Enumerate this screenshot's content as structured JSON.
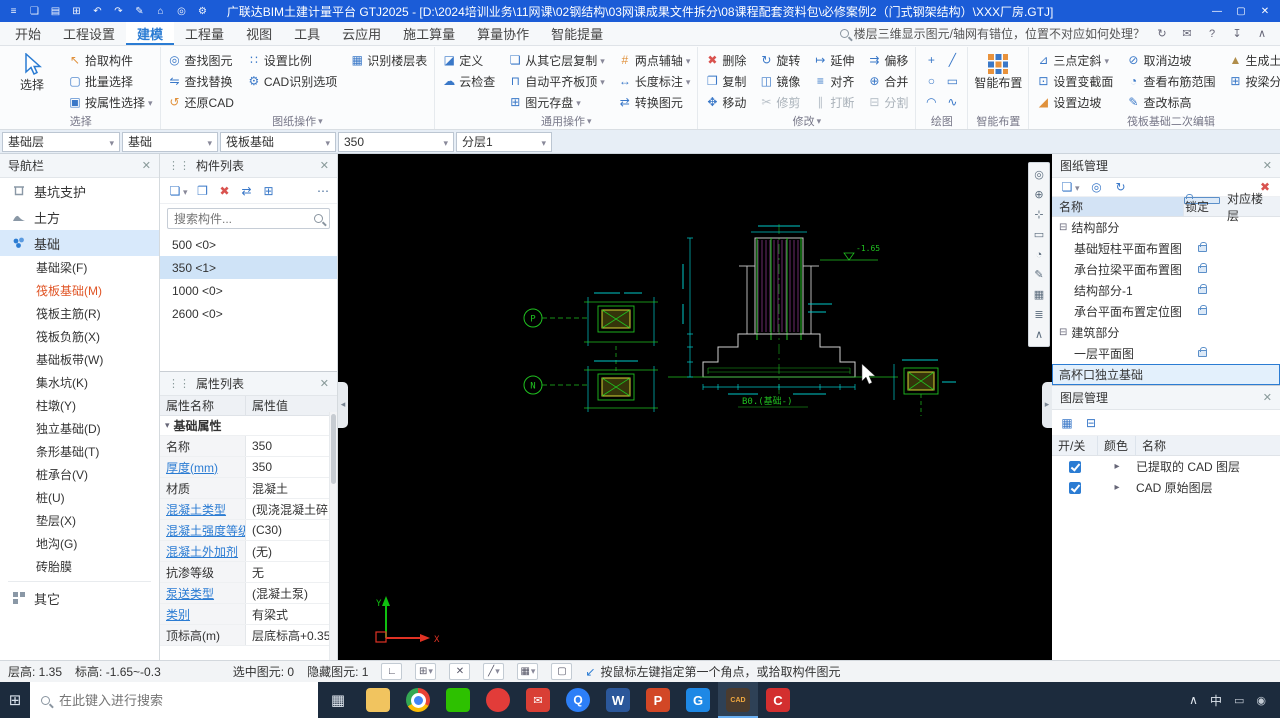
{
  "title_bar": {
    "title": "广联达BIM土建计量平台 GTJ2025 - [D:\\2024培训业务\\11网课\\02钢结构\\03网课成果文件拆分\\08课程配套资料包\\必修案例2（门式钢架结构）\\XXX厂房.GTJ]"
  },
  "tabs": {
    "items": [
      "开始",
      "工程设置",
      "建模",
      "工程量",
      "视图",
      "工具",
      "云应用",
      "施工算量",
      "算量协作",
      "智能提量"
    ],
    "active_tab": "建模",
    "help_query": "楼层三维显示图元/轴网有错位，位置不对应如何处理？"
  },
  "ribbon": {
    "g1": {
      "label": "选择",
      "big": "选择",
      "col": [
        "拾取构件",
        "批量选择",
        "按属性选择"
      ]
    },
    "g2": {
      "label": "图纸操作",
      "col1": [
        "查找图元",
        "查找替换",
        "还原CAD"
      ],
      "col2": [
        "设置比例",
        "CAD识别选项"
      ],
      "col3": [
        "识别楼层表"
      ]
    },
    "g3": {
      "label": "通用操作",
      "col1": [
        "定义",
        "云检查"
      ],
      "col2": [
        "从其它层复制",
        "自动平齐板顶",
        "图元存盘"
      ],
      "col3": [
        "两点辅轴",
        "长度标注",
        "转换图元"
      ]
    },
    "g4": {
      "label": "修改",
      "col1": [
        "删除",
        "复制",
        "移动"
      ],
      "col2": [
        "旋转",
        "镜像",
        "修剪"
      ],
      "col3": [
        "延伸",
        "对齐",
        "打断"
      ],
      "col4": [
        "偏移",
        "合并",
        "分割"
      ]
    },
    "g5": {
      "label": "绘图"
    },
    "g6": {
      "label": "智能布置",
      "big": "智能布置"
    },
    "g7": {
      "label": "筏板基础二次编辑",
      "col1": [
        "三点定斜",
        "设置变截面",
        "设置边坡"
      ],
      "col2": [
        "取消边坡",
        "查看布筋范围",
        "查改标高"
      ],
      "col3": [
        "生成土方",
        "按梁分割板"
      ]
    }
  },
  "context_bar": {
    "floor": "基础层",
    "category": "基础",
    "type": "筏板基础",
    "name": "350",
    "layer": "分层1"
  },
  "navigation": {
    "title": "导航栏",
    "top": [
      "基坑支护",
      "土方",
      "基础"
    ],
    "children": [
      "基础梁(F)",
      "筏板基础(M)",
      "筏板主筋(R)",
      "筏板负筋(X)",
      "基础板带(W)",
      "集水坑(K)",
      "柱墩(Y)",
      "独立基础(D)",
      "条形基础(T)",
      "桩承台(V)",
      "桩(U)",
      "垫层(X)",
      "地沟(G)",
      "砖胎膜"
    ],
    "bottom": "其它"
  },
  "component_list": {
    "title": "构件列表",
    "search_placeholder": "搜索构件...",
    "items": [
      "500 <0>",
      "350 <1>",
      "1000 <0>",
      "2600 <0>"
    ],
    "selected_item": "350 <1>"
  },
  "properties": {
    "title": "属性列表",
    "col_name": "属性名称",
    "col_value": "属性值",
    "group": "基础属性",
    "rows": [
      [
        "名称",
        "350"
      ],
      [
        "厚度(mm)",
        "350"
      ],
      [
        "材质",
        "混凝土"
      ],
      [
        "混凝土类型",
        "(现浇混凝土碎.."
      ],
      [
        "混凝土强度等级",
        "(C30)"
      ],
      [
        "混凝土外加剂",
        "(无)"
      ],
      [
        "抗渗等级",
        "无"
      ],
      [
        "泵送类型",
        "(混凝土泵)"
      ],
      [
        "类别",
        "有梁式"
      ],
      [
        "顶标高(m)",
        "层底标高+0.35"
      ]
    ]
  },
  "drawing_manager": {
    "title": "图纸管理",
    "col_name": "名称",
    "col_lock": "锁定",
    "col_floor": "对应楼层",
    "tree": [
      "结构部分",
      "基础短柱平面布置图",
      "承台拉梁平面布置图",
      "结构部分-1",
      "承台平面布置定位图",
      "建筑部分",
      "一层平面图",
      "高杯口独立基础"
    ],
    "selected_row": "高杯口独立基础"
  },
  "layer_manager": {
    "title": "图层管理",
    "col_switch": "开/关",
    "col_color": "颜色",
    "col_name": "名称",
    "rows": [
      "已提取的 CAD 图层",
      "CAD 原始图层"
    ]
  },
  "status_bar": {
    "floor_height": "层高: 1.35",
    "elevation": "标高: -1.65~-0.3",
    "selected": "选中图元: 0",
    "hidden": "隐藏图元: 1",
    "message": "按鼠标左键指定第一个角点，或拾取构件图元"
  },
  "canvas_labels": {
    "p": "P",
    "n": "N",
    "x": "X",
    "y": "Y",
    "note": "B0.(基础-)",
    "elev": "-1.65"
  },
  "taskbar": {
    "search_placeholder": "在此键入进行搜索",
    "ime": "中"
  },
  "icons": {
    "taskbar_apps": [
      "task-view",
      "file-explorer",
      "chrome",
      "wechat",
      "netease-music",
      "mail",
      "tim",
      "word",
      "powerpoint",
      "glodon-gtj",
      "cad",
      "c-app"
    ],
    "accent_color": "#2b7cd3"
  }
}
